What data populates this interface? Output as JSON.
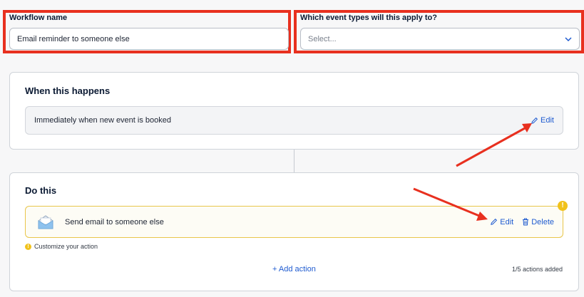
{
  "workflow_name": {
    "label": "Workflow name",
    "value": "Email reminder to someone else"
  },
  "event_types": {
    "label": "Which event types will this apply to?",
    "placeholder": "Select..."
  },
  "trigger": {
    "title": "When this happens",
    "text": "Immediately when new event is booked",
    "edit_label": "Edit"
  },
  "action": {
    "title": "Do this",
    "text": "Send email to someone else",
    "edit_label": "Edit",
    "delete_label": "Delete",
    "warning_badge": "!",
    "warning_text": "Customize your action",
    "add_label": "+ Add action",
    "count_text": "1/5 actions added"
  },
  "colors": {
    "accent": "#1f5bd0",
    "annotation_red": "#e8301f",
    "warning_yellow": "#f1c21b"
  }
}
